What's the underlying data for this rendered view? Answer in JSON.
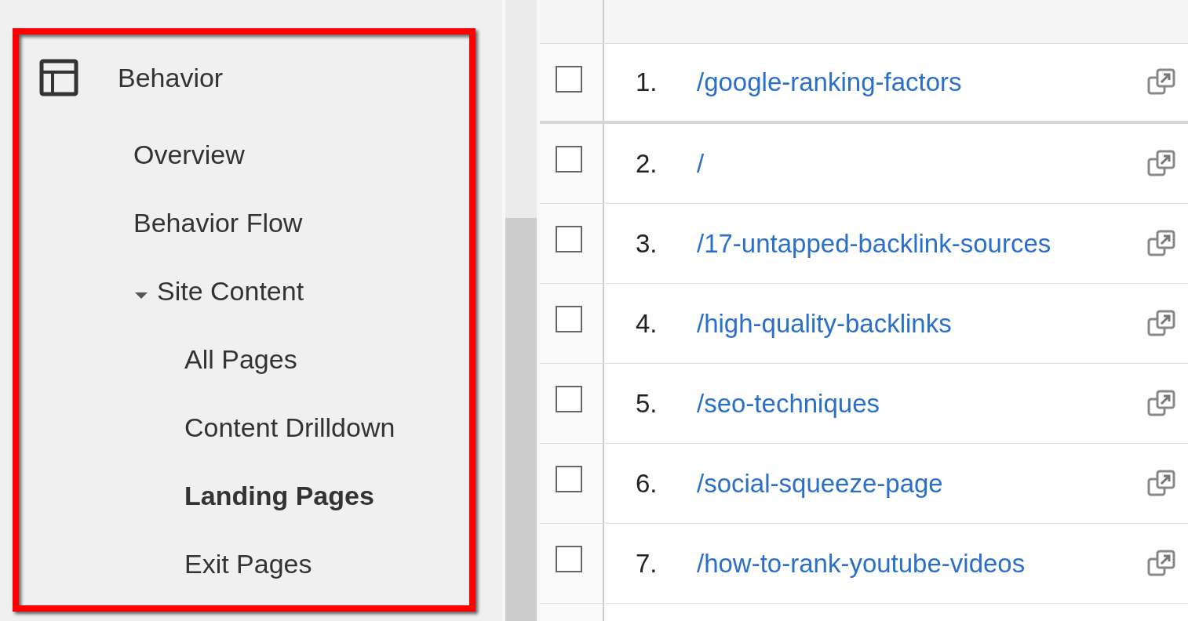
{
  "sidebar": {
    "section": {
      "title": "Behavior"
    },
    "items": [
      {
        "label": "Overview",
        "selected": false
      },
      {
        "label": "Behavior Flow",
        "selected": false
      },
      {
        "label": "Site Content",
        "selected": false,
        "expanded": true,
        "children": [
          {
            "label": "All Pages",
            "selected": false
          },
          {
            "label": "Content Drilldown",
            "selected": false
          },
          {
            "label": "Landing Pages",
            "selected": true
          },
          {
            "label": "Exit Pages",
            "selected": false
          }
        ]
      }
    ]
  },
  "table": {
    "rows": [
      {
        "number": "1.",
        "path": "/google-ranking-factors",
        "checked": false
      },
      {
        "number": "2.",
        "path": "/",
        "checked": false
      },
      {
        "number": "3.",
        "path": "/17-untapped-backlink-sources",
        "checked": false
      },
      {
        "number": "4.",
        "path": "/high-quality-backlinks",
        "checked": false
      },
      {
        "number": "5.",
        "path": "/seo-techniques",
        "checked": false
      },
      {
        "number": "6.",
        "path": "/social-squeeze-page",
        "checked": false
      },
      {
        "number": "7.",
        "path": "/how-to-rank-youtube-videos",
        "checked": false
      }
    ]
  }
}
